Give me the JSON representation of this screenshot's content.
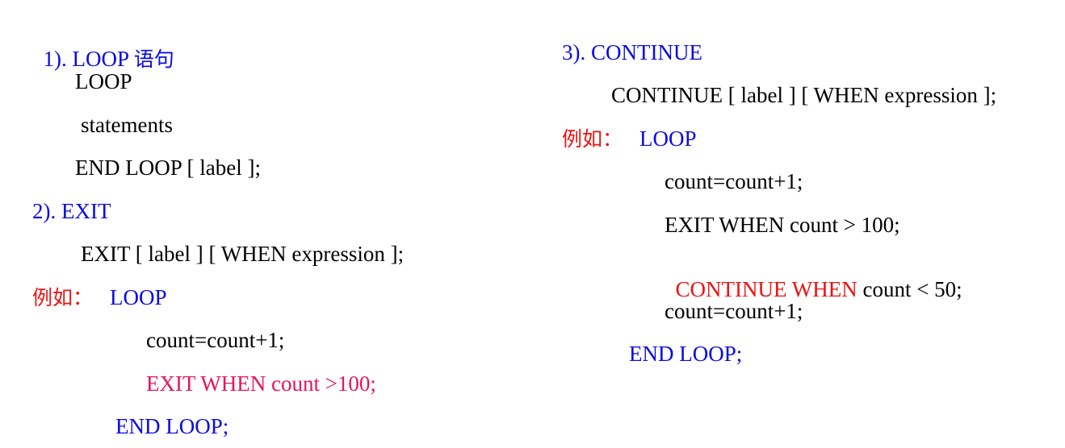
{
  "left": {
    "heading1": {
      "prefix": "1). LOOP ",
      "suffix": "语句"
    },
    "syntax1": [
      "LOOP",
      "statements",
      "END LOOP [ label ];"
    ],
    "heading2": "2). EXIT",
    "syntax2": "EXIT [ label ] [ WHEN expression ];",
    "example_label": "例如：",
    "example_loop": "LOOP",
    "example_lines": [
      "count=count+1;",
      "EXIT WHEN count >100;"
    ],
    "example_end": "END LOOP;"
  },
  "right": {
    "heading3": "3). CONTINUE",
    "syntax3": "CONTINUE [ label ] [ WHEN expression ];",
    "example_label": "例如：",
    "example_loop": "LOOP",
    "line1": "count=count+1;",
    "line2": "EXIT WHEN count > 100;",
    "line3_keyword": "CONTINUE WHEN",
    "line3_rest": " count < 50;",
    "line4": "count=count+1;",
    "example_end": "END LOOP;"
  },
  "colors": {
    "heading_blue": "#0a0ae6",
    "example_red": "#ee1111",
    "exit_pink": "#e8145c",
    "body_black": "#000000"
  }
}
